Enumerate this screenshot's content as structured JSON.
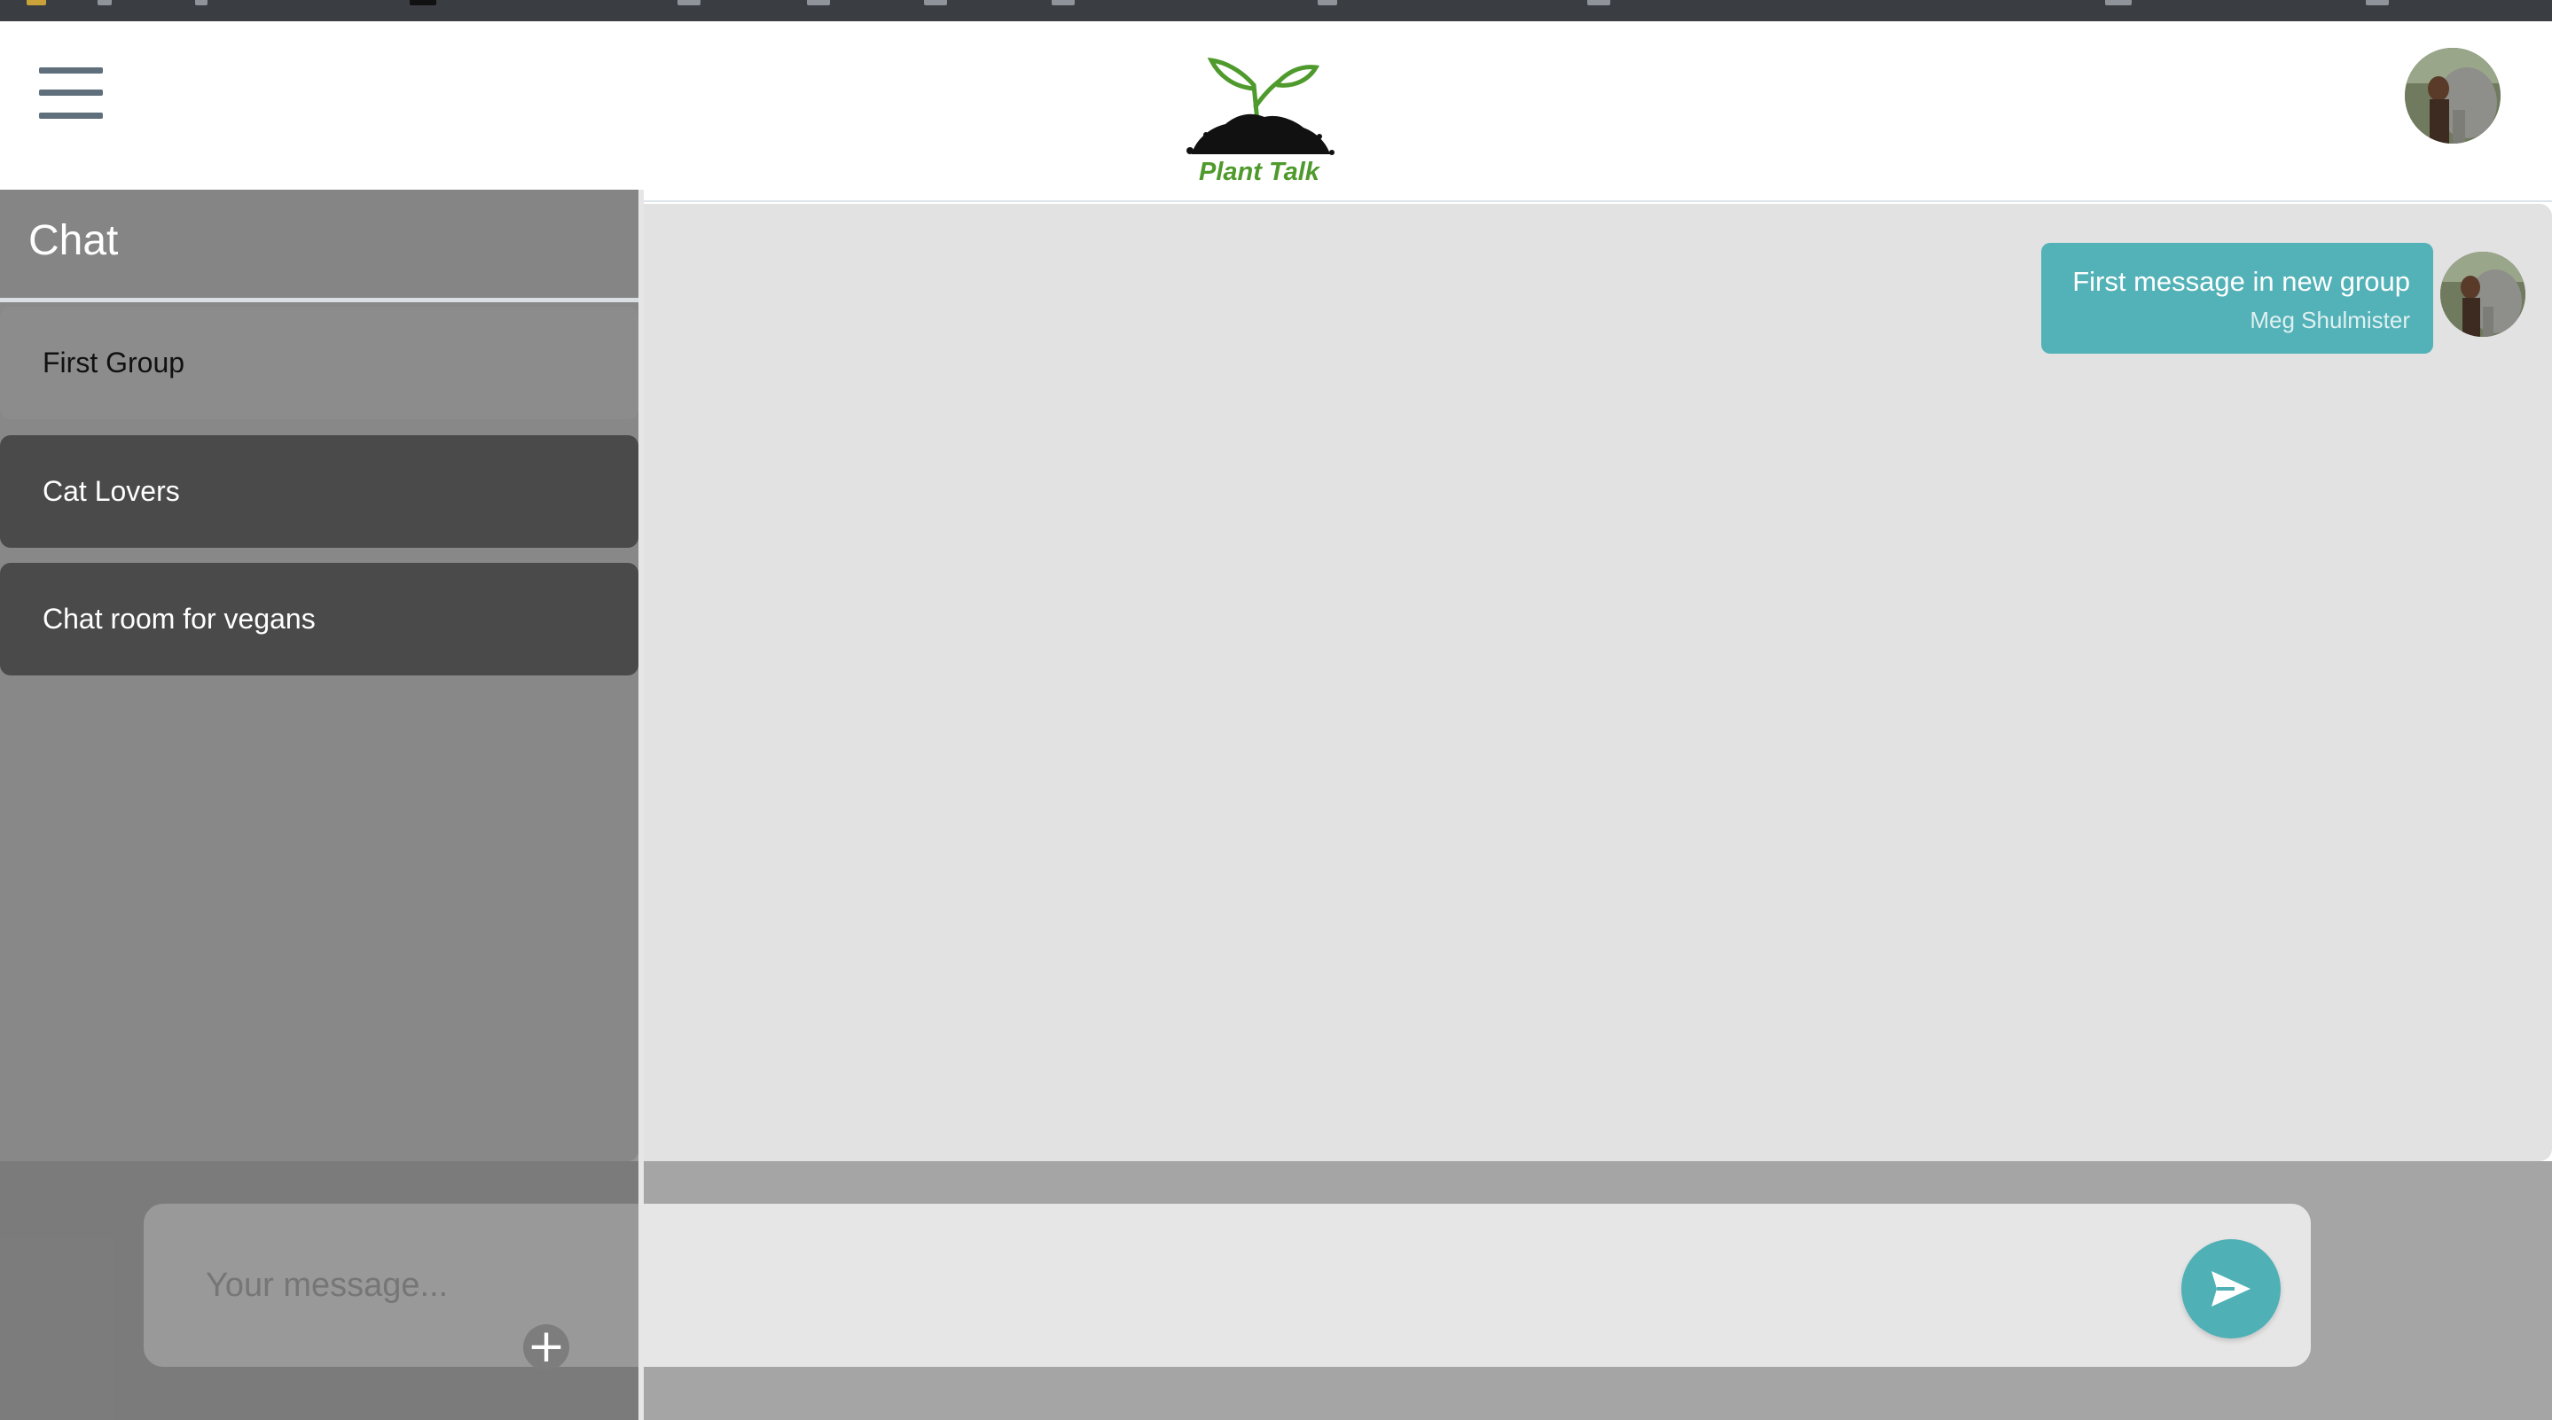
{
  "app": {
    "logo_text": "Plant Talk",
    "brand_color": "#4f9a2c",
    "accent_color": "#52b2b8"
  },
  "header": {
    "menu_icon": "hamburger-menu-icon",
    "user_avatar": "user-avatar"
  },
  "sidebar": {
    "title": "Chat",
    "items": [
      {
        "label": "First Group"
      },
      {
        "label": "Cat Lovers"
      },
      {
        "label": "Chat room for vegans"
      }
    ]
  },
  "messages": [
    {
      "text": "First message in new group",
      "author": "Meg Shulmister"
    }
  ],
  "composer": {
    "placeholder": "Your message...",
    "value": "",
    "send_icon": "send-icon",
    "add_icon": "plus-icon"
  }
}
